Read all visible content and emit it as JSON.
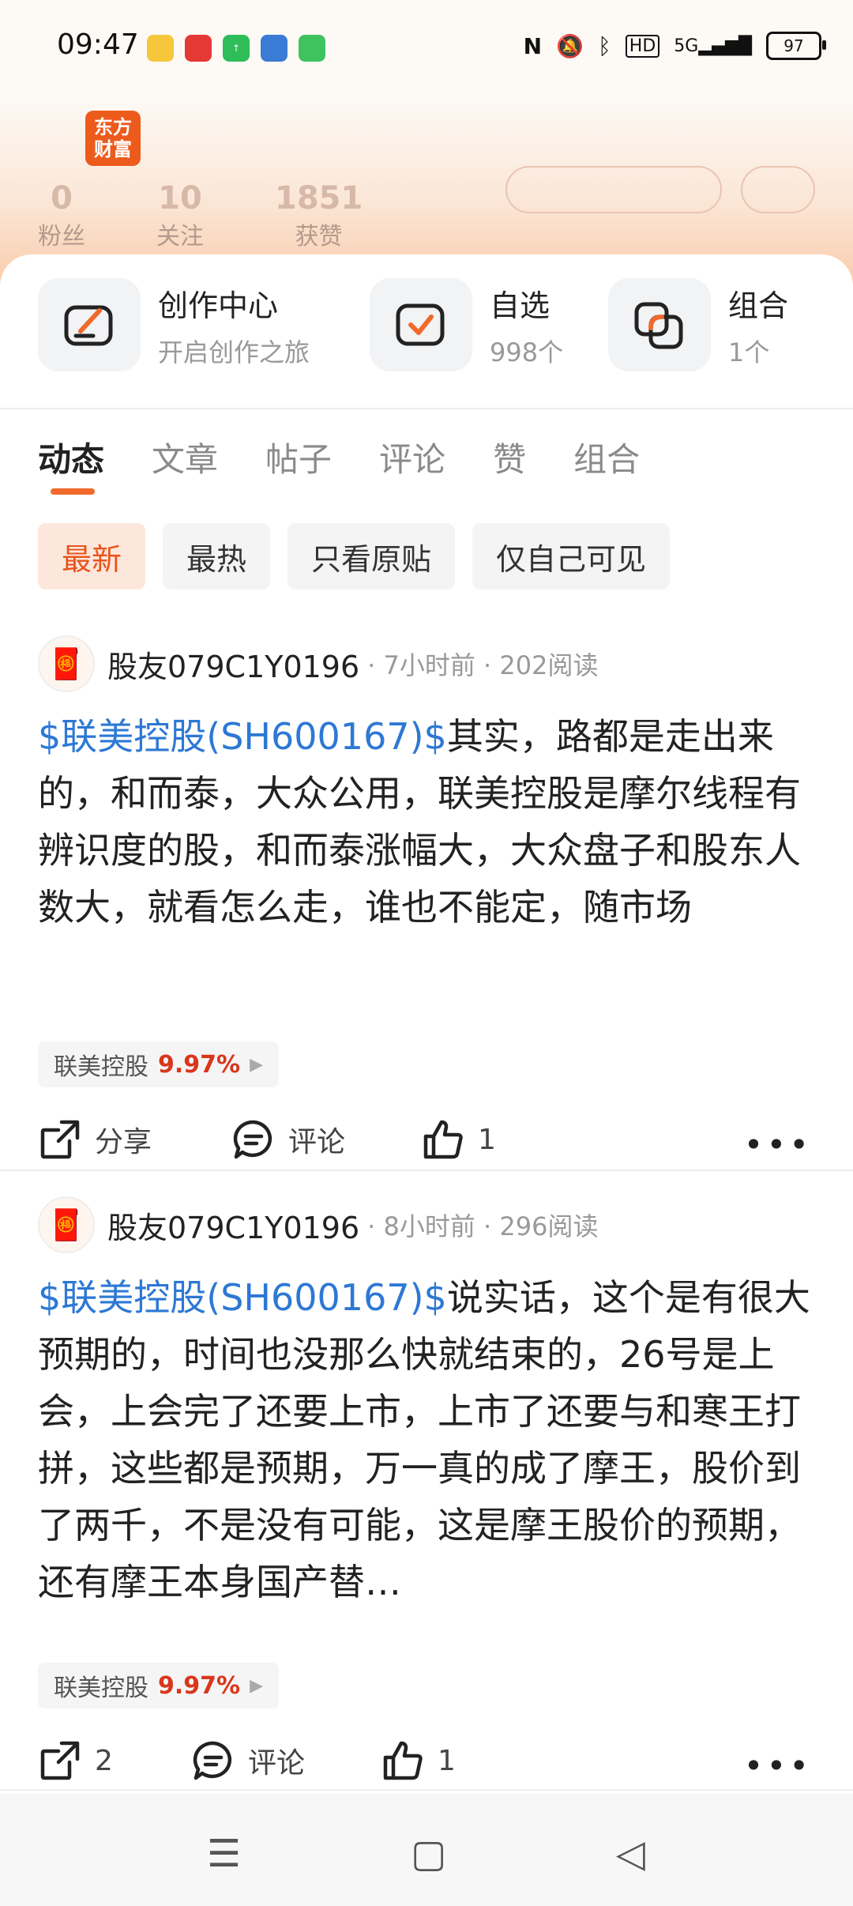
{
  "status_bar": {
    "time": "09:47",
    "battery": "97",
    "network": "5G",
    "hd": "HD",
    "nfc": "N"
  },
  "header": {
    "brand_logo": [
      "东方",
      "财富"
    ],
    "stats": [
      {
        "value": "0",
        "label": "粉丝"
      },
      {
        "value": "10",
        "label": "关注"
      },
      {
        "value": "1851",
        "label": "获赞"
      }
    ]
  },
  "shortcuts": [
    {
      "title": "创作中心",
      "sub": "开启创作之旅",
      "icon": "edit-icon"
    },
    {
      "title": "自选",
      "sub": "998个",
      "icon": "checkbox-icon"
    },
    {
      "title": "组合",
      "sub": "1个",
      "icon": "portfolio-icon"
    }
  ],
  "tabs": [
    "动态",
    "文章",
    "帖子",
    "评论",
    "赞",
    "组合"
  ],
  "filters": [
    "最新",
    "最热",
    "只看原贴",
    "仅自己可见"
  ],
  "posts": [
    {
      "user": "股友079C1Y0196",
      "meta": "· 7小时前 · 202阅读",
      "tag": "$联美控股(SH600167)$",
      "text": "其实，路都是走出来的，和而泰，大众公用，联美控股是摩尔线程有辨识度的股，和而泰涨幅大，大众盘子和股东人数大，就看怎么走，谁也不能定，随市场",
      "stock_name": "联美控股",
      "stock_pct": "9.97%",
      "share": "分享",
      "comment": "评论",
      "likes": "1"
    },
    {
      "user": "股友079C1Y0196",
      "meta": "· 8小时前 · 296阅读",
      "tag": "$联美控股(SH600167)$",
      "text": "说实话，这个是有很大预期的，时间也没那么快就结束的，26号是上会，上会完了还要上市，上市了还要与和寒王打拼，这些都是预期，万一真的成了摩王，股价到了两千，不是没有可能，这是摩王股价的预期，还有摩王本身国产替…",
      "stock_name": "联美控股",
      "stock_pct": "9.97%",
      "share": "2",
      "comment": "评论",
      "likes": "1"
    }
  ],
  "colors": {
    "accent": "#f06a2b",
    "link": "#2d78d4",
    "rise": "#d9361b"
  }
}
